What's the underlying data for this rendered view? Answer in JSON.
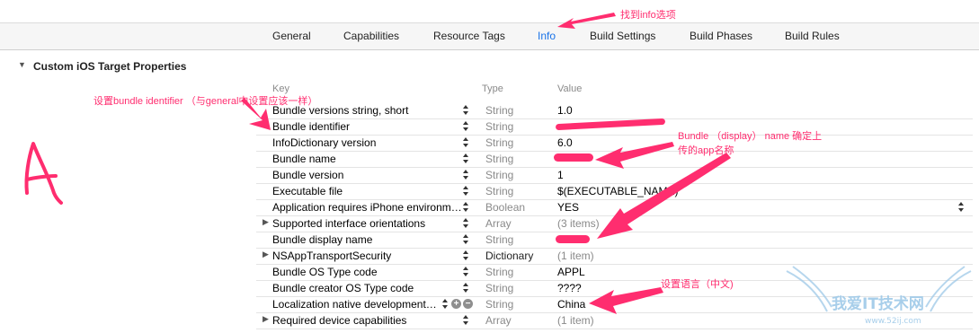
{
  "tabs": [
    {
      "label": "General",
      "active": false
    },
    {
      "label": "Capabilities",
      "active": false
    },
    {
      "label": "Resource Tags",
      "active": false
    },
    {
      "label": "Info",
      "active": true
    },
    {
      "label": "Build Settings",
      "active": false
    },
    {
      "label": "Build Phases",
      "active": false
    },
    {
      "label": "Build Rules",
      "active": false
    }
  ],
  "section": {
    "title": "Custom iOS Target Properties"
  },
  "headers": {
    "key": "Key",
    "type": "Type",
    "value": "Value"
  },
  "rows": [
    {
      "key": "Bundle versions string, short",
      "type": "String",
      "value": "1.0"
    },
    {
      "key": "Bundle identifier",
      "type": "String",
      "value": ""
    },
    {
      "key": "InfoDictionary version",
      "type": "String",
      "value": "6.0"
    },
    {
      "key": "Bundle name",
      "type": "String",
      "value": ""
    },
    {
      "key": "Bundle version",
      "type": "String",
      "value": "1"
    },
    {
      "key": "Executable file",
      "type": "String",
      "value": "$(EXECUTABLE_NAME)"
    },
    {
      "key": "Application requires iPhone environm…",
      "type": "Boolean",
      "value": "YES"
    },
    {
      "key": "Supported interface orientations",
      "type": "Array",
      "value": "(3 items)"
    },
    {
      "key": "Bundle display name",
      "type": "String",
      "value": ""
    },
    {
      "key": "NSAppTransportSecurity",
      "type": "Dictionary",
      "value": "(1 item)"
    },
    {
      "key": "Bundle OS Type code",
      "type": "String",
      "value": "APPL"
    },
    {
      "key": "Bundle creator OS Type code",
      "type": "String",
      "value": "????"
    },
    {
      "key": "Localization native development…",
      "type": "String",
      "value": "China"
    },
    {
      "key": "Required device capabilities",
      "type": "Array",
      "value": "(1 item)"
    }
  ],
  "annotations": {
    "find_info": "找到info选项",
    "set_bundle_id": "设置bundle  identifier    （与general中设置应该一样）",
    "bundle_name_1": "Bundle （display） name 确定上",
    "bundle_name_2": "传的app名称",
    "set_language": "设置语言（中文)",
    "handwritten_letter": "A"
  },
  "watermark": {
    "text": "我爱IT技术网",
    "url": "www.52ij.com"
  },
  "colors": {
    "accent": "#ff2d6f",
    "active_tab": "#1a73e8",
    "row_line": "#e4e4e4"
  }
}
